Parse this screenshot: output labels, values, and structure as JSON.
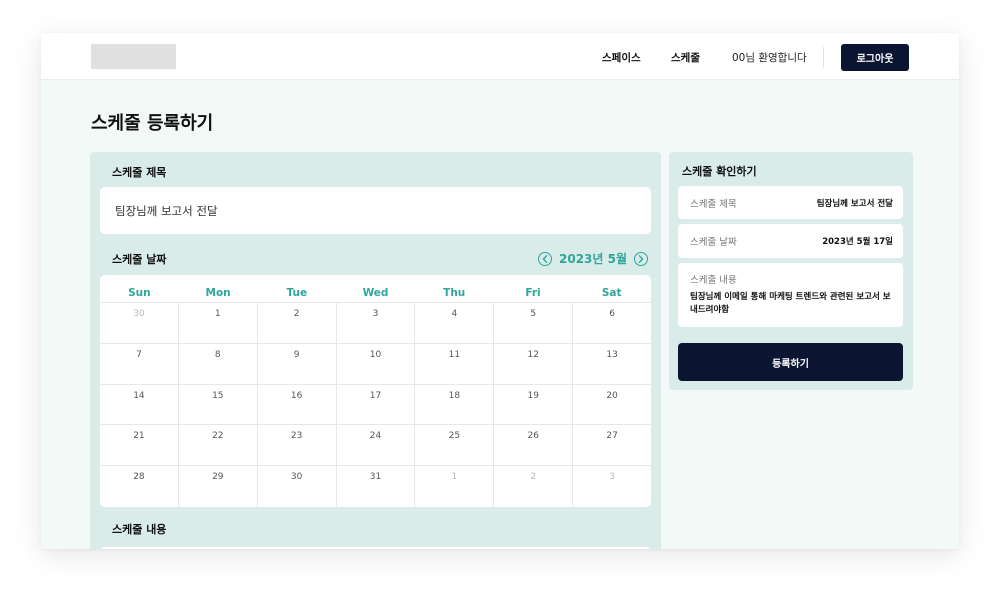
{
  "header": {
    "nav": [
      {
        "label": "스페이스"
      },
      {
        "label": "스케줄"
      }
    ],
    "welcome": "00님 환영합니다",
    "logout_label": "로그아웃"
  },
  "page": {
    "title": "스케줄 등록하기"
  },
  "form": {
    "title_label": "스케줄 제목",
    "title_value": "팀장님께 보고서 전달",
    "date_label": "스케줄 날짜",
    "content_label": "스케줄 내용"
  },
  "calendar": {
    "month_label": "2023년 5월",
    "weekdays": [
      "Sun",
      "Mon",
      "Tue",
      "Wed",
      "Thu",
      "Fri",
      "Sat"
    ],
    "weeks": [
      [
        "30",
        "1",
        "2",
        "3",
        "4",
        "5",
        "6"
      ],
      [
        "7",
        "8",
        "9",
        "10",
        "11",
        "12",
        "13"
      ],
      [
        "14",
        "15",
        "16",
        "17",
        "18",
        "19",
        "20"
      ],
      [
        "21",
        "22",
        "23",
        "24",
        "25",
        "26",
        "27"
      ],
      [
        "28",
        "29",
        "30",
        "31",
        "1",
        "2",
        "3"
      ]
    ]
  },
  "confirm": {
    "heading": "스케줄 확인하기",
    "title_label": "스케줄 제목",
    "title_value": "팀장님께 보고서 전달",
    "date_label": "스케줄 날짜",
    "date_value": "2023년 5월 17일",
    "content_label": "스케줄 내용",
    "content_value": "팀장님께 이메일 통해 마케팅 트렌드와 관련된 보고서 보내드려야함",
    "submit_label": "등록하기"
  },
  "colors": {
    "accent": "#2fa69a",
    "navy": "#0b1531",
    "panel": "#d9ecea",
    "background": "#f3f9f7"
  }
}
